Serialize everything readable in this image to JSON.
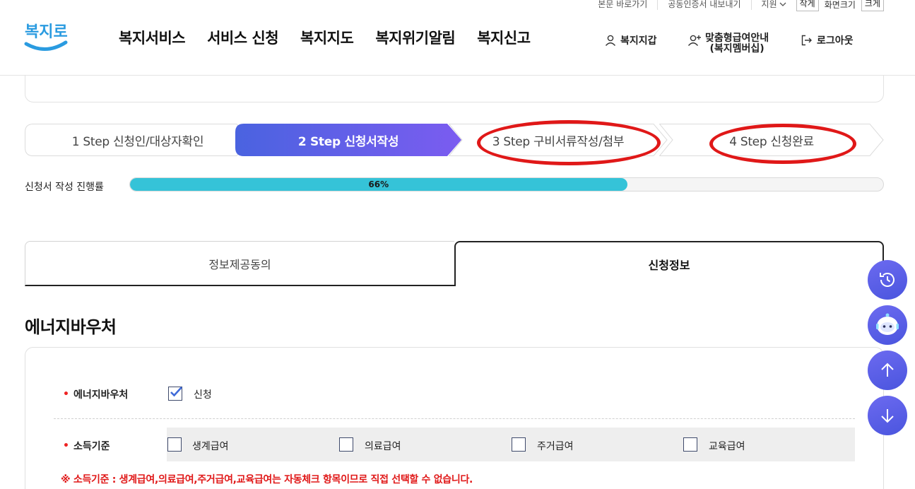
{
  "header": {
    "util_links": [
      "본문 바로가기",
      "공동인증서 내보내기"
    ],
    "support_label": "지원",
    "font_small": "작게",
    "font_label": "화면크기",
    "font_big": "크게",
    "logo_text": "복지로",
    "gnb": [
      "복지서비스",
      "서비스 신청",
      "복지지도",
      "복지위기알림",
      "복지신고"
    ],
    "wallet": "복지지갑",
    "custom_line1": "맞춤형급여안내",
    "custom_line2": "(복지멤버십)",
    "logout": "로그아웃"
  },
  "steps": [
    {
      "label": "1 Step 신청인/대상자확인",
      "state": "done"
    },
    {
      "label": "2 Step 신청서작성",
      "state": "active"
    },
    {
      "label": "3 Step 구비서류작성/첨부",
      "state": "todo"
    },
    {
      "label": "4 Step 신청완료",
      "state": "todo"
    }
  ],
  "progress": {
    "label": "신청서 작성 진행률",
    "value_text": "66%",
    "value": 0.66
  },
  "tabs": {
    "consent": "정보제공동의",
    "info": "신청정보"
  },
  "section": {
    "title": "에너지바우처",
    "voucher_label": "에너지바우처",
    "voucher_option": "신청",
    "voucher_checked": true,
    "income_label": "소득기준",
    "income_options": [
      "생계급여",
      "의료급여",
      "주거급여",
      "교육급여"
    ],
    "notice": "※ 소득기준 : 생계급여,의료급여,주거급여,교육급여는 자동체크 항목이므로 직접 선택할 수 없습니다."
  },
  "colors": {
    "active_step_start": "#4a63e0",
    "active_step_end": "#7b5cf0",
    "progress": "#35c3d8",
    "annotation": "#e01818",
    "logo_blue": "#2a9be0",
    "logo_green": "#3ec46d"
  }
}
